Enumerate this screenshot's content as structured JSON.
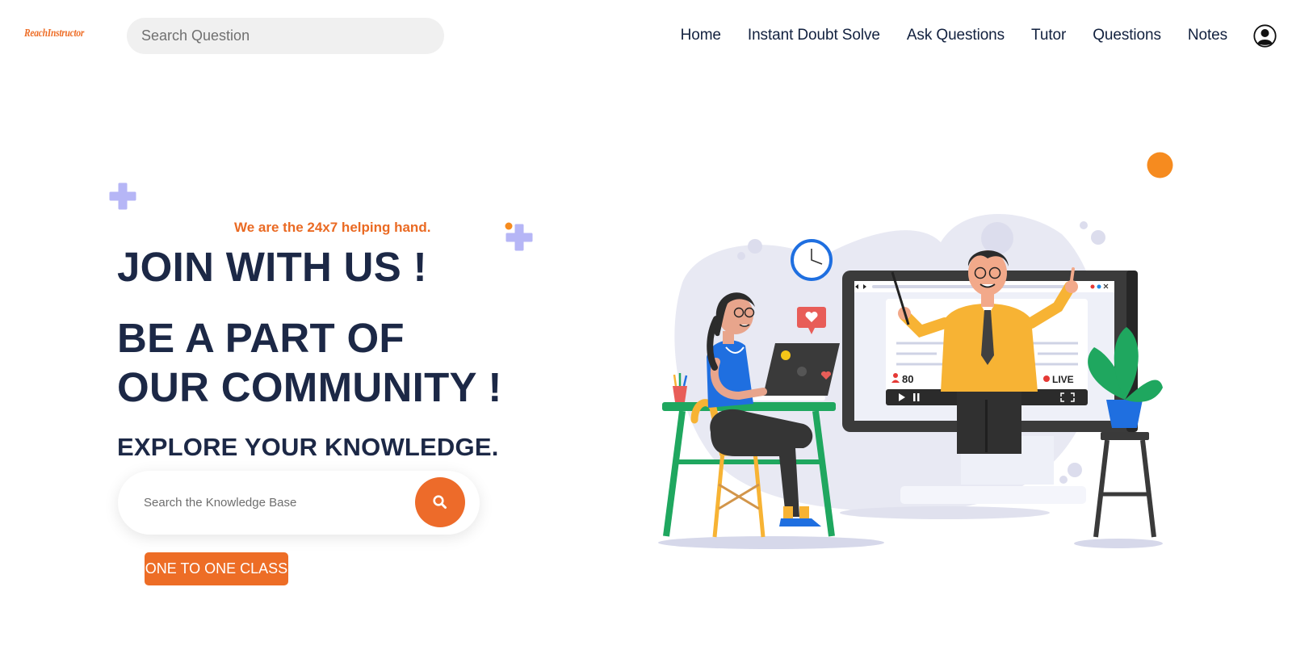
{
  "header": {
    "logo": "ReachInstructor",
    "search_placeholder": "Search Question",
    "nav": [
      {
        "label": "Home"
      },
      {
        "label": "Instant Doubt Solve"
      },
      {
        "label": "Ask Questions"
      },
      {
        "label": "Tutor"
      },
      {
        "label": "Questions"
      },
      {
        "label": "Notes"
      }
    ]
  },
  "hero": {
    "tagline": "We are the 24x7 helping hand.",
    "heading1": "JOIN WITH US !",
    "heading2": "BE A PART OF OUR COMMUNITY !",
    "heading3": "EXPLORE YOUR KNOWLEDGE.",
    "search_placeholder": "Search the Knowledge Base",
    "cta_label": "ONE TO ONE CLASS"
  },
  "illustration": {
    "viewer_count": "80",
    "live_label": "LIVE"
  },
  "colors": {
    "accent": "#ed6b2a",
    "heading": "#1c2846",
    "decor_plus": "#b3b5f5",
    "decor_dot": "#f68b1f"
  }
}
